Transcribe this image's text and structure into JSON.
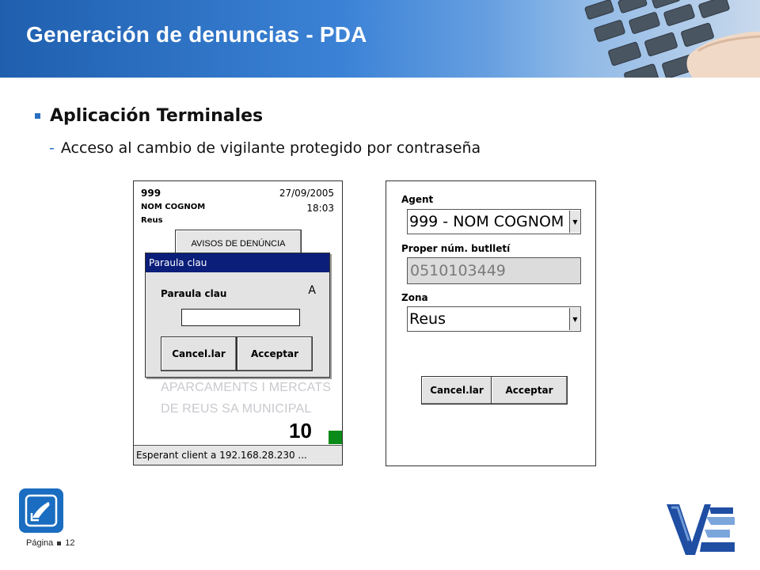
{
  "header": {
    "title": "Generación de denuncias - PDA"
  },
  "content": {
    "bullet_main": "Aplicación Terminales",
    "bullet_sub": "Acceso al cambio de vigilante protegido por contraseña"
  },
  "pda_left": {
    "agent": "999",
    "name": "NOM COGNOM",
    "city": "Reus",
    "date": "27/09/2005",
    "time": "18:03",
    "avisos_button": "AVISOS DE DENÚNCIA",
    "dialog": {
      "title": "Paraula clau",
      "label": "Paraula clau",
      "input_mode": "A",
      "input_value": "",
      "cancel_label": "Cancel.lar",
      "accept_label": "Acceptar"
    },
    "watermark_line1": "APARCAMENTS I MERCATS",
    "watermark_line2": "DE REUS SA MUNICIPAL",
    "count": "10",
    "status": "Esperant client a 192.168.28.230 ...",
    "status_color": "#0a8a18"
  },
  "pda_right": {
    "agent_label": "Agent",
    "agent_value": "999 - NOM COGNOM",
    "bulletin_label": "Proper núm. butlletí",
    "bulletin_value": "0510103449",
    "zone_label": "Zona",
    "zone_value": "Reus",
    "cancel_label": "Cancel.lar",
    "accept_label": "Acceptar"
  },
  "footer": {
    "page_label": "Página",
    "page_number": "12",
    "icon": "hand-touch-icon",
    "logo": "ve-logo"
  },
  "colors": {
    "header_start": "#1f5fae",
    "accent": "#2b6fc2",
    "dialog_title": "#0a1e7a"
  }
}
